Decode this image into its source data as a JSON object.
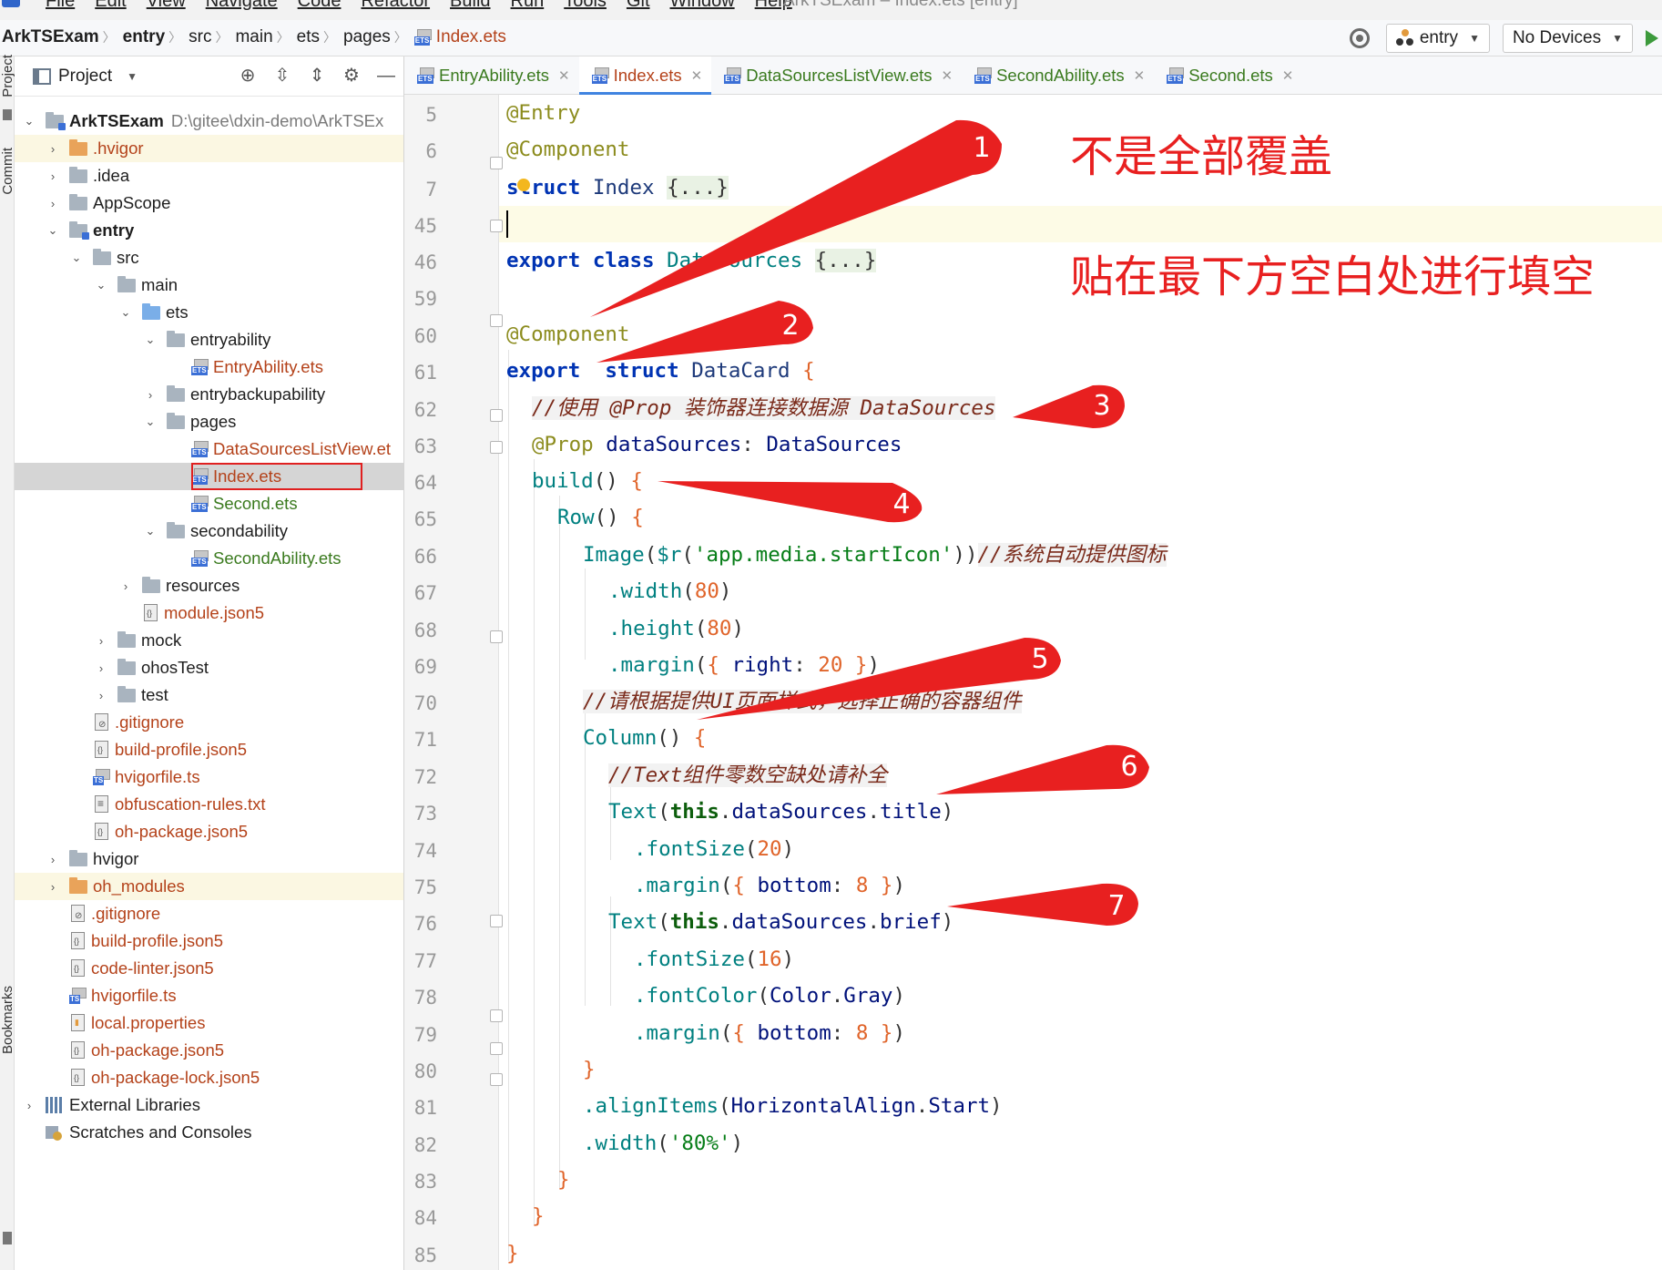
{
  "menu": {
    "items": [
      "File",
      "Edit",
      "View",
      "Navigate",
      "Code",
      "Refactor",
      "Build",
      "Run",
      "Tools",
      "Git",
      "Window",
      "Help"
    ],
    "window_title": "ArkTSExam – Index.ets [entry]"
  },
  "breadcrumb": [
    "ArkTSExam",
    "entry",
    "src",
    "main",
    "ets",
    "pages",
    "Index.ets"
  ],
  "run": {
    "module": "entry",
    "device": "No Devices"
  },
  "project_panel": {
    "title": "Project",
    "root_name": "ArkTSExam",
    "root_path": "D:\\gitee\\dxin-demo\\ArkTSEx",
    "items": [
      ".hvigor",
      ".idea",
      "AppScope",
      "entry",
      "src",
      "main",
      "ets",
      "entryability",
      "EntryAbility.ets",
      "entrybackupability",
      "pages",
      "DataSourcesListView.et",
      "Index.ets",
      "Second.ets",
      "secondability",
      "SecondAbility.ets",
      "resources",
      "module.json5",
      "mock",
      "ohosTest",
      "test",
      ".gitignore",
      "build-profile.json5",
      "hvigorfile.ts",
      "obfuscation-rules.txt",
      "oh-package.json5",
      "hvigor",
      "oh_modules",
      ".gitignore",
      "build-profile.json5",
      "code-linter.json5",
      "hvigorfile.ts",
      "local.properties",
      "oh-package.json5",
      "oh-package-lock.json5",
      "External Libraries",
      "Scratches and Consoles"
    ]
  },
  "side_tools": {
    "project": "Project",
    "commit": "Commit",
    "bookmarks": "Bookmarks"
  },
  "tabs": [
    "EntryAbility.ets",
    "Index.ets",
    "DataSourcesListView.ets",
    "SecondAbility.ets",
    "Second.ets"
  ],
  "editor": {
    "line_numbers": [
      "5",
      "6",
      "7",
      "45",
      "46",
      "59",
      "60",
      "61",
      "62",
      "63",
      "64",
      "65",
      "66",
      "67",
      "68",
      "69",
      "70",
      "71",
      "72",
      "73",
      "74",
      "75",
      "76",
      "77",
      "78",
      "79",
      "80",
      "81",
      "82",
      "83",
      "84",
      "85"
    ],
    "code": {
      "l5": "@Entry",
      "l6": "@Component",
      "l7_kw": "struct",
      "l7_name": "Index",
      "fold": "{...}",
      "l46_kw": "export class",
      "l46_name": "DataSources",
      "l60": "@Component",
      "l61_kw1": "export",
      "l61_kw2": "struct",
      "l61_name": "DataCard",
      "l62": "//使用 @Prop 装饰器连接数据源 DataSources",
      "l63_dec": "@Prop",
      "l63_field": "dataSources",
      "l63_type": "DataSources",
      "l64": "build",
      "l65": "Row",
      "l66_fn": "Image",
      "l66_r": "$r",
      "l66_str": "'app.media.startIcon'",
      "l66_cm": "//系统自动提供图标",
      "width": ".width",
      "height": ".height",
      "margin": ".margin",
      "n80": "80",
      "right": "right",
      "n20": "20",
      "l70": "//请根据提供UI页面样式，选择正确的容器组件",
      "l71": "Column",
      "l72": "//Text组件零数空缺处请补全",
      "text": "Text",
      "this": "this",
      "ds": "dataSources",
      "title": "title",
      "brief": "brief",
      "fontSize": ".fontSize",
      "fontColor": ".fontColor",
      "color": "Color",
      "gray": "Gray",
      "bottom": "bottom",
      "n8": "8",
      "n16": "16",
      "alignItems": ".alignItems",
      "halign": "HorizontalAlign",
      "start": "Start",
      "w80p": "'80%'"
    }
  },
  "annotations": {
    "note1": "不是全部覆盖",
    "note2": "贴在最下方空白处进行填空",
    "markers": [
      "1",
      "2",
      "3",
      "4",
      "5",
      "6",
      "7"
    ]
  },
  "colors": {
    "annotation_red": "#e82020",
    "accent_blue": "#4083e0",
    "file_name_orange": "#b4421a"
  }
}
